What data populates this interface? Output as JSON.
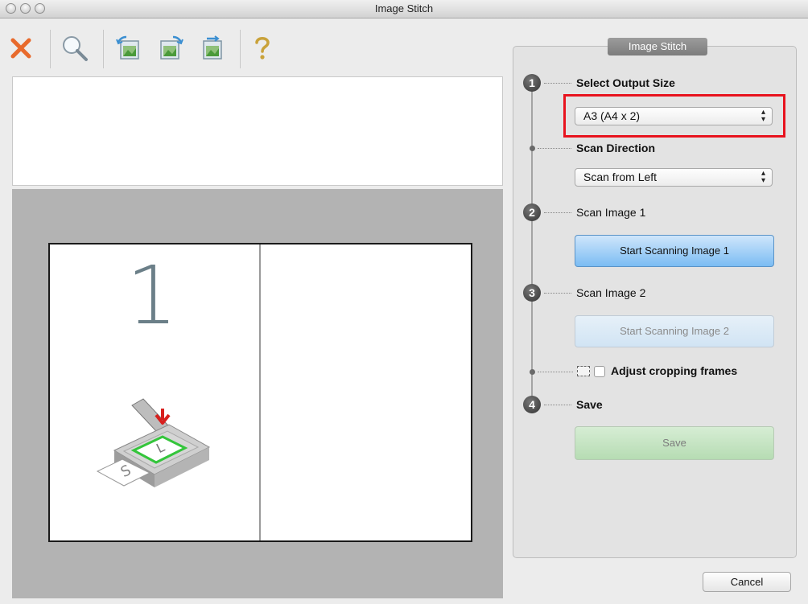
{
  "window": {
    "title": "Image Stitch"
  },
  "toolbar": {
    "items": [
      {
        "name": "delete",
        "icon": "delete-x-icon"
      },
      {
        "name": "zoom",
        "icon": "magnifier-icon"
      },
      {
        "name": "rotate-left",
        "icon": "image-rotate-left-icon"
      },
      {
        "name": "rotate-right",
        "icon": "image-rotate-right-icon"
      },
      {
        "name": "swap",
        "icon": "image-swap-icon"
      },
      {
        "name": "help",
        "icon": "help-question-icon"
      }
    ]
  },
  "preview": {
    "image_number": "1"
  },
  "panel": {
    "title": "Image Stitch",
    "step1": {
      "number": "1",
      "label": "Select Output Size",
      "select_value": "A3 (A4 x 2)"
    },
    "scan_direction": {
      "label": "Scan Direction",
      "select_value": "Scan from Left"
    },
    "step2": {
      "number": "2",
      "label": "Scan Image 1",
      "button": "Start Scanning Image 1"
    },
    "step3": {
      "number": "3",
      "label": "Scan Image 2",
      "button": "Start Scanning Image 2"
    },
    "crop": {
      "label": "Adjust cropping frames",
      "checked": false
    },
    "step4": {
      "number": "4",
      "label": "Save",
      "button": "Save"
    }
  },
  "footer": {
    "cancel": "Cancel"
  },
  "colors": {
    "highlight": "#e8131e",
    "primary_button": "#7bbcf3",
    "save_button": "#b6dcb3"
  }
}
